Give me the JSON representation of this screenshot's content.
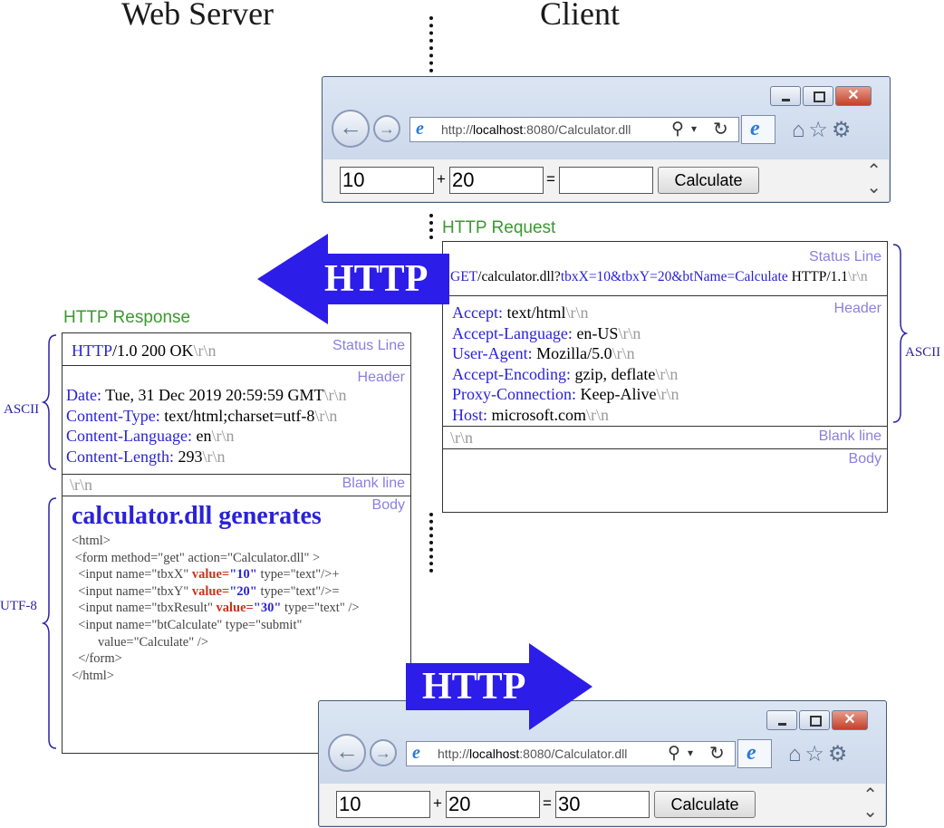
{
  "headings": {
    "server": "Web Server",
    "client": "Client"
  },
  "browser": {
    "url_prefix": "http://",
    "url_host": "localhost",
    "url_rest": ":8080/Calculator.dll",
    "button_label": "Calculate",
    "plus": "+",
    "equals": "=",
    "top": {
      "x": "10",
      "y": "20",
      "result": ""
    },
    "bottom": {
      "x": "10",
      "y": "20",
      "result": "30"
    }
  },
  "arrows": {
    "left_label": "HTTP",
    "right_label": "HTTP"
  },
  "request": {
    "title": "HTTP Request",
    "status_label": "Status Line",
    "status_line": {
      "part1": "GET",
      "part2": "/calculator.dll?",
      "part3": "tbxX=10&tbxY=20&btName=Calculate",
      "part4": " HTTP/1.1",
      "crlf": "\\r\\n"
    },
    "header_label": "Header",
    "headers": [
      {
        "key": "Accept:",
        "value": " text/html",
        "crlf": "\\r\\n"
      },
      {
        "key": "Accept-Language:",
        "value": " en-US",
        "crlf": "\\r\\n"
      },
      {
        "key": "User-Agent:",
        "value": " Mozilla/5.0",
        "crlf": "\\r\\n"
      },
      {
        "key": "Accept-Encoding:",
        "value": " gzip, deflate",
        "crlf": "\\r\\n"
      },
      {
        "key": "Proxy-Connection:",
        "value": " Keep-Alive",
        "crlf": "\\r\\n"
      },
      {
        "key": "Host:",
        "value": " microsoft.com",
        "crlf": "\\r\\n"
      }
    ],
    "blank_crlf": "\\r\\n",
    "blank_label": "Blank line",
    "body_label": "Body",
    "encoding_label": "ASCII"
  },
  "response": {
    "title": "HTTP Response",
    "status_label": "Status Line",
    "status_line": {
      "part1": "HTTP",
      "part2": "/1.0 200 OK",
      "crlf": "\\r\\n"
    },
    "header_label": "Header",
    "headers": [
      {
        "key": "Date:",
        "value": " Tue, 31 Dec 2019 20:59:59 GMT",
        "crlf": "\\r\\n"
      },
      {
        "key": "Content-Type:",
        "value": " text/html;charset=utf-8",
        "crlf": "\\r\\n"
      },
      {
        "key": "Content-Language:",
        "value": " en",
        "crlf": "\\r\\n"
      },
      {
        "key": "Content-Length:",
        "value": " 293",
        "crlf": "\\r\\n"
      }
    ],
    "blank_crlf": "\\r\\n",
    "blank_label": "Blank line",
    "body_label": "Body",
    "body_title": "calculator.dll generates",
    "code": {
      "l1": "<html>",
      "l2": " <form method=\"get\" action=\"Calculator.dll\" >",
      "l3a": "  <input name=\"tbxX\" ",
      "l3b": "value=",
      "l3c": "\"10\"",
      "l3d": " type=\"text\"/>+",
      "l4a": "  <input name=\"tbxY\" ",
      "l4b": "value=",
      "l4c": "\"20\"",
      "l4d": " type=\"text\"/>=",
      "l5a": "  <input name=\"tbxResult\" ",
      "l5b": "value=",
      "l5c": "\"30\"",
      "l5d": " type=\"text\" />",
      "l6": "  <input name=\"btCalculate\" type=\"submit\"",
      "l7": "        value=\"Calculate\" />",
      "l8": "  </form>",
      "l9": "</html>"
    },
    "encoding_ascii": "ASCII",
    "encoding_utf8": "UTF-8"
  }
}
